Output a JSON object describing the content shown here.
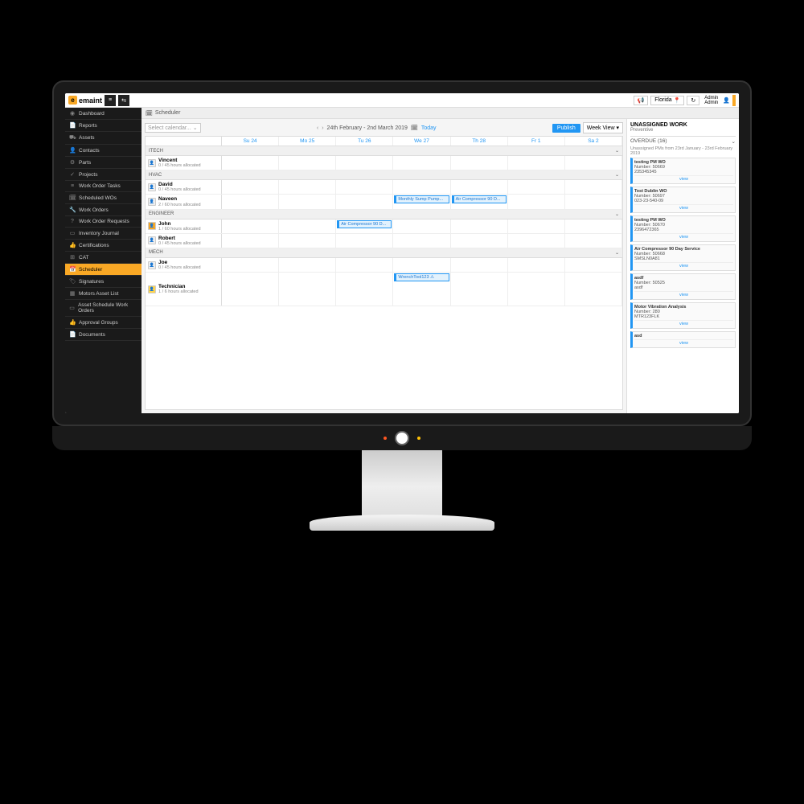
{
  "brand": {
    "logo_letter": "e",
    "name": "emaint"
  },
  "topbar": {
    "location": "Florida",
    "user_line1": "Admin",
    "user_line2": "Admin"
  },
  "sidebar": {
    "items": [
      {
        "icon": "◉",
        "label": "Dashboard"
      },
      {
        "icon": "📄",
        "label": "Reports"
      },
      {
        "icon": "⛟",
        "label": "Assets"
      },
      {
        "icon": "👤",
        "label": "Contacts"
      },
      {
        "icon": "⚙",
        "label": "Parts"
      },
      {
        "icon": "✓",
        "label": "Projects"
      },
      {
        "icon": "≡",
        "label": "Work Order Tasks"
      },
      {
        "icon": "🗓",
        "label": "Scheduled WOs"
      },
      {
        "icon": "🔧",
        "label": "Work Orders"
      },
      {
        "icon": "?",
        "label": "Work Order Requests"
      },
      {
        "icon": "▭",
        "label": "Inventory Journal"
      },
      {
        "icon": "👍",
        "label": "Certifications"
      },
      {
        "icon": "⊞",
        "label": "CAT"
      },
      {
        "icon": "📅",
        "label": "Scheduler",
        "active": true
      },
      {
        "icon": "🏷",
        "label": "Signatures"
      },
      {
        "icon": "▦",
        "label": "Motors Asset List"
      },
      {
        "icon": "▭",
        "label": "Asset Schedule Work Orders"
      },
      {
        "icon": "👍",
        "label": "Approval Groups"
      },
      {
        "icon": "📄",
        "label": "Documents"
      }
    ]
  },
  "breadcrumb": {
    "title": "Scheduler"
  },
  "toolbar": {
    "calendar_placeholder": "Select calendar...",
    "date_range": "24th February - 2nd March 2019",
    "today": "Today",
    "publish": "Publish",
    "view": "Week View ▾"
  },
  "days": [
    {
      "label": "Su 24"
    },
    {
      "label": "Mo 25"
    },
    {
      "label": "Tu 26"
    },
    {
      "label": "We 27"
    },
    {
      "label": "Th 28"
    },
    {
      "label": "Fr 1"
    },
    {
      "label": "Sa 2"
    }
  ],
  "groups": [
    {
      "name": "ITECH",
      "resources": [
        {
          "name": "Vincent",
          "alloc": "0 / 45 hours allocated"
        }
      ]
    },
    {
      "name": "HVAC",
      "resources": [
        {
          "name": "David",
          "alloc": "0 / 45 hours allocated"
        },
        {
          "name": "Naveen",
          "alloc": "2 / 60 hours allocated",
          "events": [
            {
              "day": 3,
              "label": "Monthly Sump Pump..."
            },
            {
              "day": 4,
              "label": "Air Compressor 90 D..."
            }
          ]
        }
      ]
    },
    {
      "name": "ENGINEER",
      "resources": [
        {
          "name": "John",
          "alloc": "1 / 60 hours allocated",
          "avatar": "color1",
          "events": [
            {
              "day": 2,
              "label": "Air Compressor 90 D..."
            }
          ]
        },
        {
          "name": "Robert",
          "alloc": "0 / 45 hours allocated"
        }
      ]
    },
    {
      "name": "MECH",
      "resources": [
        {
          "name": "Joe",
          "alloc": "0 / 45 hours allocated"
        },
        {
          "name": "Technician",
          "alloc": "1 / 6 hours allocated",
          "avatar": "color2",
          "events": [
            {
              "day": 3,
              "label": "WrenchTool123      ⚠"
            }
          ],
          "tall": true
        }
      ]
    }
  ],
  "unassigned": {
    "title": "UNASSIGNED WORK",
    "subtitle": "Preventive",
    "section": "OVERDUE (16)",
    "note": "Unassigned PMs from 23rd January - 23rd February 2019",
    "cards": [
      {
        "title": "testing PM WO",
        "line1": "Number: 50669",
        "line2": "235345345"
      },
      {
        "title": "Test Dublin WO",
        "line1": "Number: 50697",
        "line2": "023-23-540-09"
      },
      {
        "title": "testing PM WO",
        "line1": "Number: 50670",
        "line2": "2396472365"
      },
      {
        "title": "Air Compressor 90 Day Service",
        "line1": "Number: 50668",
        "line2": "SMSLN0A81"
      },
      {
        "title": "asdf",
        "line1": "Number: 50525",
        "line2": "asdf"
      },
      {
        "title": "Motor Vibration Analysis",
        "line1": "Number: 280",
        "line2": "MTR123FLK"
      },
      {
        "title": "asd",
        "line1": "",
        "line2": ""
      }
    ],
    "view_label": "view"
  }
}
